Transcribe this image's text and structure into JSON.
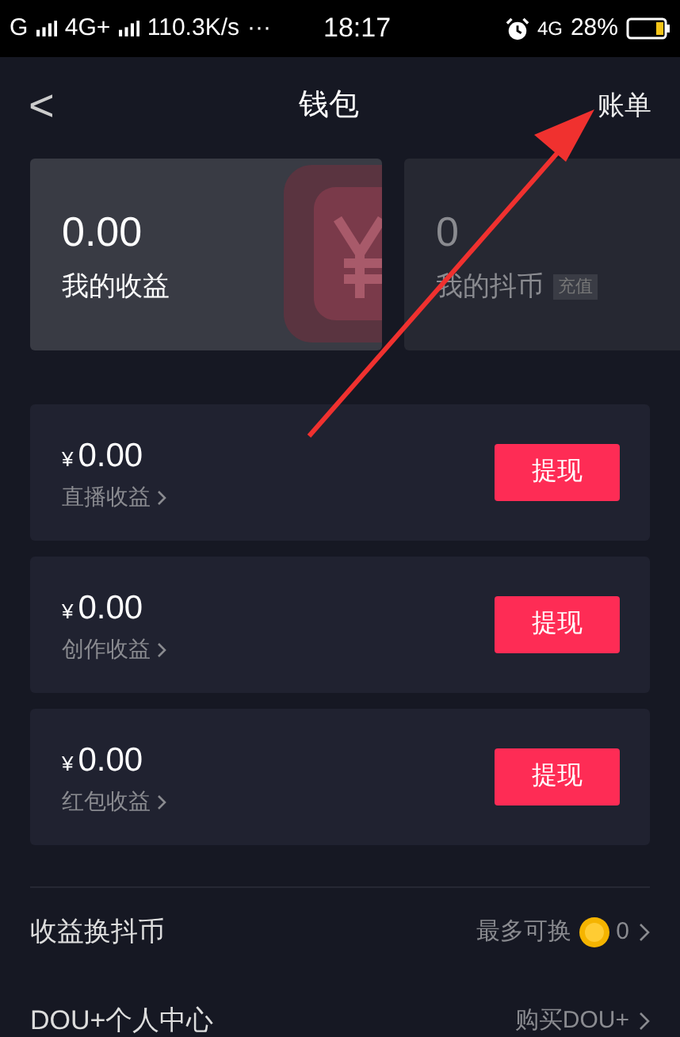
{
  "status_bar": {
    "carrier1": "G",
    "carrier2": "4G+",
    "speed": "110.3K/s",
    "dots": "···",
    "time": "18:17",
    "network": "4G",
    "battery": "28%"
  },
  "header": {
    "back": "<",
    "title": "钱包",
    "action": "账单"
  },
  "cards": [
    {
      "amount": "0.00",
      "label": "我的收益",
      "kind": "income"
    },
    {
      "amount": "0",
      "label": "我的抖币",
      "badge": "充值",
      "kind": "coin"
    }
  ],
  "earnings": [
    {
      "currency": "¥",
      "amount": "0.00",
      "label": "直播收益",
      "button": "提现"
    },
    {
      "currency": "¥",
      "amount": "0.00",
      "label": "创作收益",
      "button": "提现"
    },
    {
      "currency": "¥",
      "amount": "0.00",
      "label": "红包收益",
      "button": "提现"
    }
  ],
  "menu": [
    {
      "label": "收益换抖币",
      "hint": "最多可换",
      "value": "0",
      "kind": "coin"
    },
    {
      "label": "DOU+个人中心",
      "hint": "购买DOU+",
      "kind": "plain"
    }
  ]
}
